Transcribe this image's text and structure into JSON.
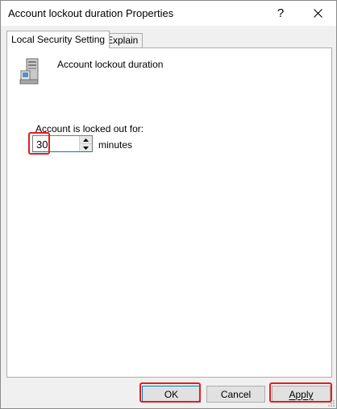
{
  "window": {
    "title": "Account lockout duration Properties",
    "help_glyph": "?",
    "close_icon": "close-icon"
  },
  "tabs": [
    {
      "label": "Local Security Setting",
      "active": true
    },
    {
      "label": "Explain",
      "active": false
    }
  ],
  "policy": {
    "icon": "server-computer-icon",
    "name": "Account lockout duration"
  },
  "setting": {
    "label": "Account is locked out for:",
    "value": "30",
    "unit": "minutes"
  },
  "buttons": {
    "ok": "OK",
    "cancel": "Cancel",
    "apply": "Apply"
  },
  "colors": {
    "highlight": "#e0201a",
    "focus_accent": "#0078d7"
  }
}
